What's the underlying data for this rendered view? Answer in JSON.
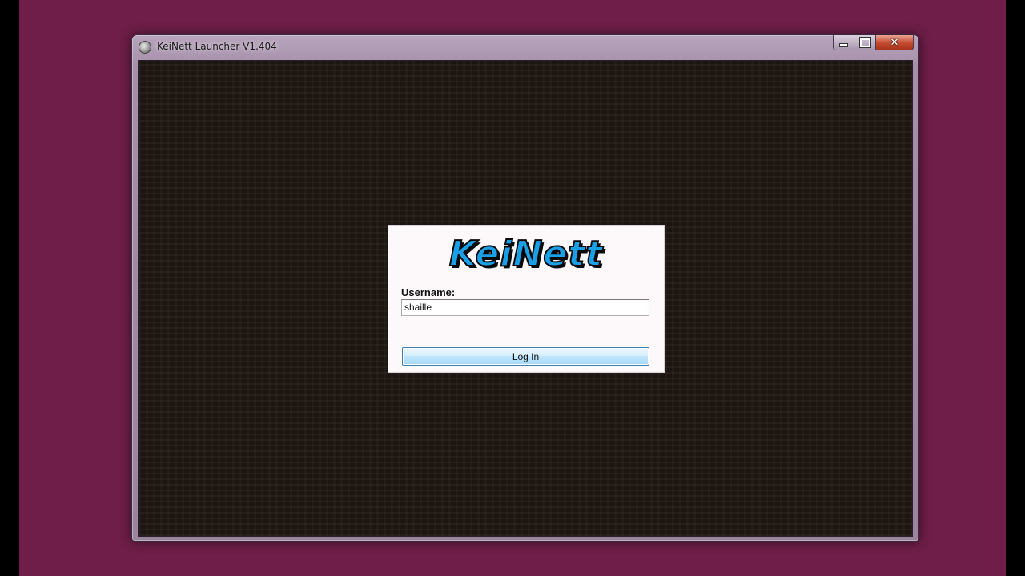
{
  "window": {
    "title": "KeiNett Launcher V1.404",
    "app_icon": "launcher-app-icon",
    "caption_buttons": {
      "minimize_icon": "minimize-icon",
      "maximize_icon": "maximize-icon",
      "close_glyph": "✕"
    }
  },
  "login": {
    "logo_text": "KeiNett",
    "username_label": "Username:",
    "username_value": "shaille",
    "button_label": "Log In"
  },
  "colors": {
    "desktop_bg": "#6e1e48",
    "logo_fill": "#1aa0e6",
    "client_bg": "#1b1612"
  }
}
